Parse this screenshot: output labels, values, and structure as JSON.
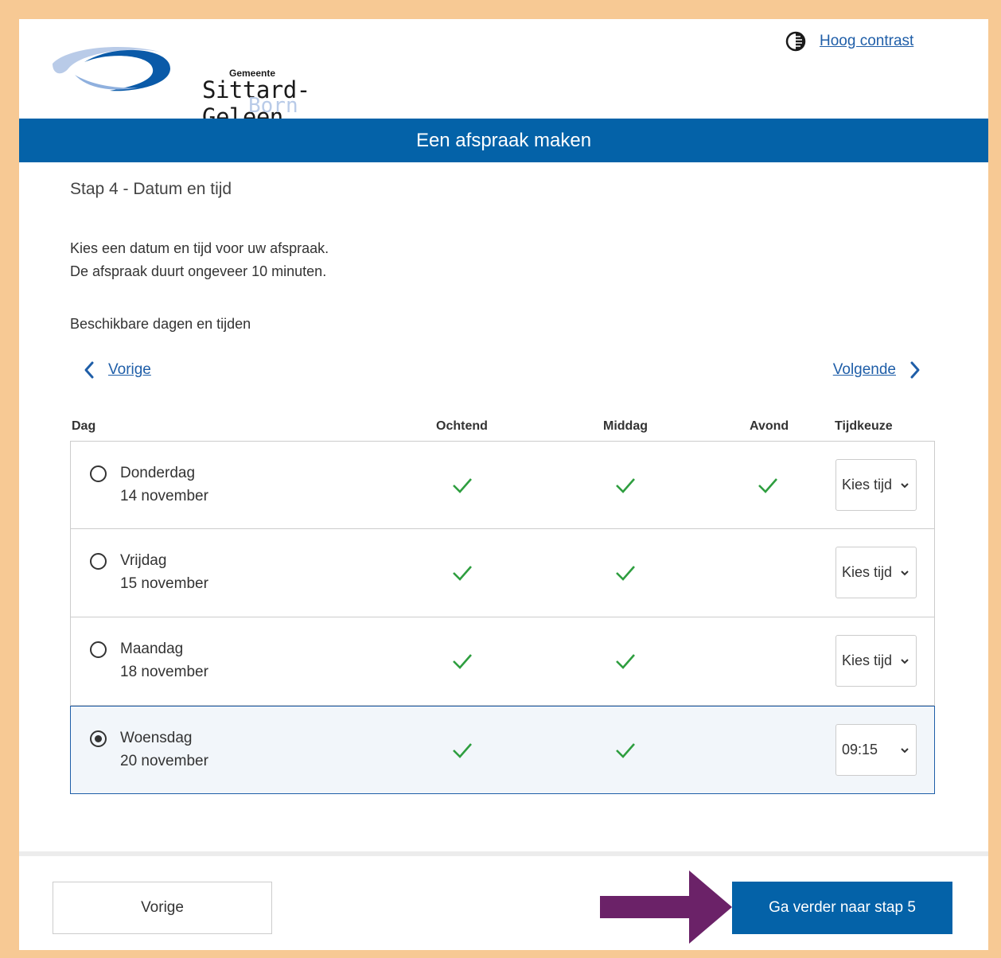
{
  "header": {
    "logo_small": "Gemeente",
    "logo_main": "Sittard-Geleen",
    "logo_sub": "Born",
    "contrast_label": "Hoog contrast"
  },
  "banner": {
    "title": "Een afspraak maken"
  },
  "step": {
    "title": "Stap 4 - Datum en tijd"
  },
  "intro": {
    "line1": "Kies een datum en tijd voor uw afspraak.",
    "line2": "De afspraak duurt ongeveer 10 minuten."
  },
  "availability": {
    "label": "Beschikbare dagen en tijden"
  },
  "navigation": {
    "prev_label": "Vorige",
    "next_label": "Volgende"
  },
  "table": {
    "headers": {
      "day": "Dag",
      "morning": "Ochtend",
      "afternoon": "Middag",
      "evening": "Avond",
      "time": "Tijdkeuze"
    },
    "rows": [
      {
        "day": "Donderdag",
        "date": "14 november",
        "morning": true,
        "afternoon": true,
        "evening": true,
        "time": "Kies tijd",
        "selected": false
      },
      {
        "day": "Vrijdag",
        "date": "15 november",
        "morning": true,
        "afternoon": true,
        "evening": false,
        "time": "Kies tijd",
        "selected": false
      },
      {
        "day": "Maandag",
        "date": "18 november",
        "morning": true,
        "afternoon": true,
        "evening": false,
        "time": "Kies tijd",
        "selected": false
      },
      {
        "day": "Woensdag",
        "date": "20 november",
        "morning": true,
        "afternoon": true,
        "evening": false,
        "time": "09:15",
        "selected": true
      }
    ]
  },
  "footer": {
    "prev_button": "Vorige",
    "next_button": "Ga verder naar stap 5"
  },
  "colors": {
    "primary": "#0462a8",
    "link": "#1f5ea8",
    "check": "#2e9e3f",
    "arrow": "#6b2268",
    "frame": "#f7c994"
  }
}
